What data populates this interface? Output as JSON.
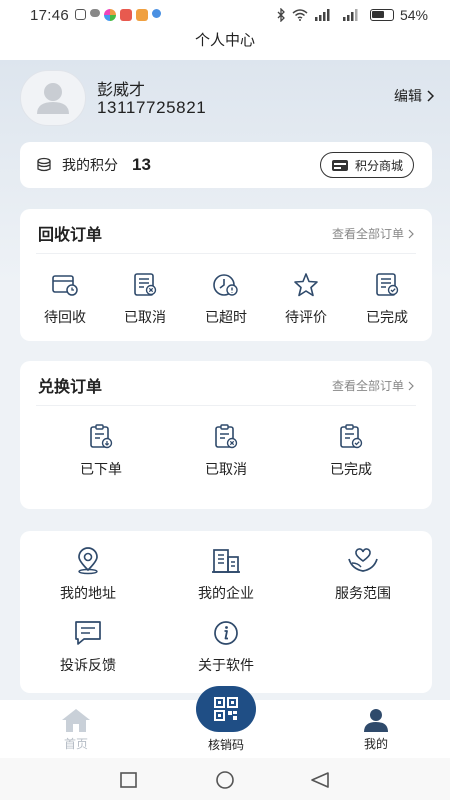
{
  "status_bar": {
    "time": "17:46",
    "battery": "54%"
  },
  "header": {
    "title": "个人中心"
  },
  "profile": {
    "name": "彭威才",
    "phone": "13117725821",
    "edit_label": "编辑"
  },
  "points": {
    "label": "我的积分",
    "value": "13",
    "mall_label": "积分商城"
  },
  "recycle_orders": {
    "title": "回收订单",
    "view_all": "查看全部订单",
    "items": [
      {
        "label": "待回收",
        "icon": "pending-recycle-icon"
      },
      {
        "label": "已取消",
        "icon": "cancelled-icon"
      },
      {
        "label": "已超时",
        "icon": "timeout-icon"
      },
      {
        "label": "待评价",
        "icon": "star-icon"
      },
      {
        "label": "已完成",
        "icon": "completed-icon"
      }
    ]
  },
  "exchange_orders": {
    "title": "兑换订单",
    "view_all": "查看全部订单",
    "items": [
      {
        "label": "已下单",
        "icon": "ordered-icon"
      },
      {
        "label": "已取消",
        "icon": "cancelled-icon"
      },
      {
        "label": "已完成",
        "icon": "completed-icon"
      }
    ]
  },
  "services": {
    "items": [
      {
        "label": "我的地址",
        "icon": "location-icon"
      },
      {
        "label": "我的企业",
        "icon": "building-icon"
      },
      {
        "label": "服务范围",
        "icon": "heart-hand-icon"
      },
      {
        "label": "投诉反馈",
        "icon": "message-icon"
      },
      {
        "label": "关于软件",
        "icon": "info-icon"
      }
    ]
  },
  "bottom_nav": {
    "home": "首页",
    "scan": "核销码",
    "mine": "我的"
  },
  "colors": {
    "accent": "#1f4e85",
    "icon_stroke": "#2f4a6b"
  }
}
